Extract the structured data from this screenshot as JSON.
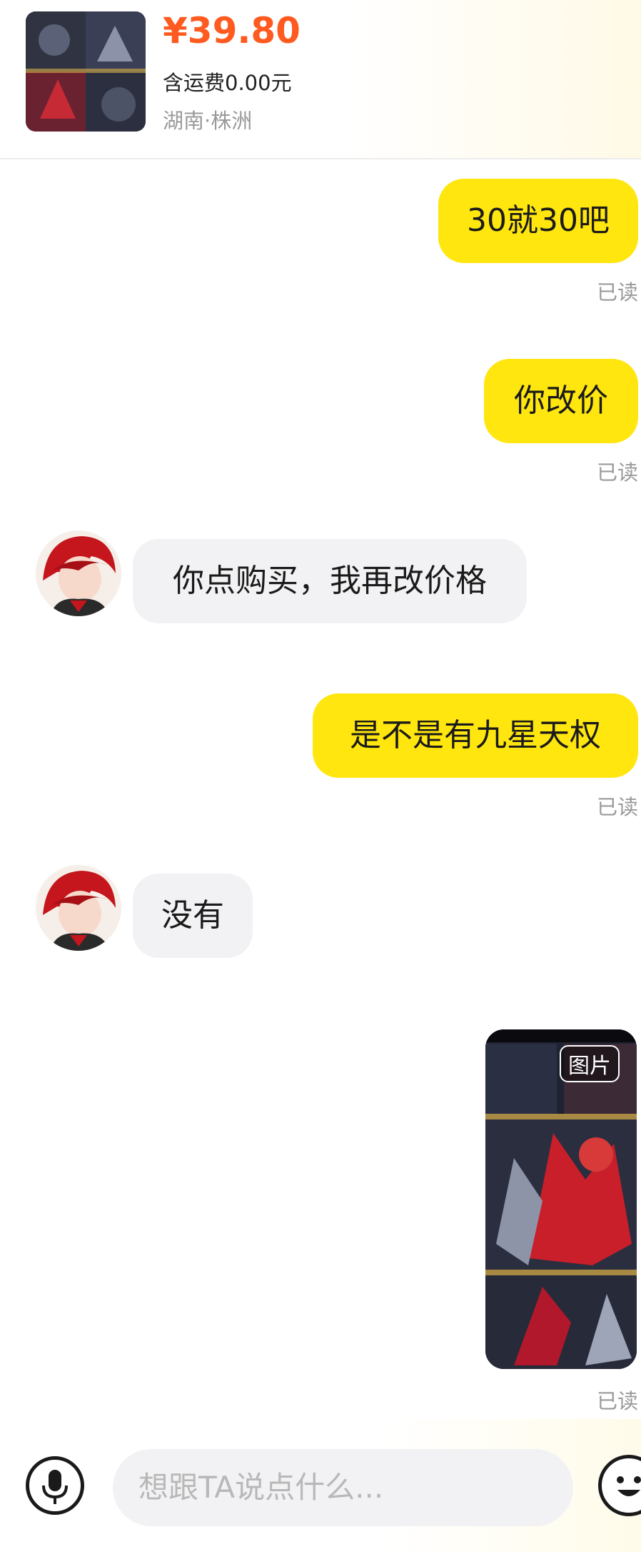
{
  "product": {
    "price": "¥39.80",
    "shipping": "含运费0.00元",
    "location": "湖南·株洲"
  },
  "messages": [
    {
      "side": "right",
      "text": "30就30吧",
      "status": "已读"
    },
    {
      "side": "right",
      "text": "你改价",
      "status": "已读"
    },
    {
      "side": "left",
      "text": "你点购买，我再改价格"
    },
    {
      "side": "right",
      "text": "是不是有九星天权",
      "status": "已读"
    },
    {
      "side": "left",
      "text": "没有"
    },
    {
      "side": "right",
      "type": "image",
      "tag": "图片",
      "status": "已读"
    }
  ],
  "input": {
    "placeholder": "想跟TA说点什么..."
  },
  "icons": {
    "voice": "microphone-icon",
    "emoji": "emoji-icon"
  },
  "colors": {
    "accent_price": "#ff5a1f",
    "bubble_mine": "#ffe60f",
    "bubble_other": "#f2f2f4",
    "status_text": "#9a9a9a"
  }
}
